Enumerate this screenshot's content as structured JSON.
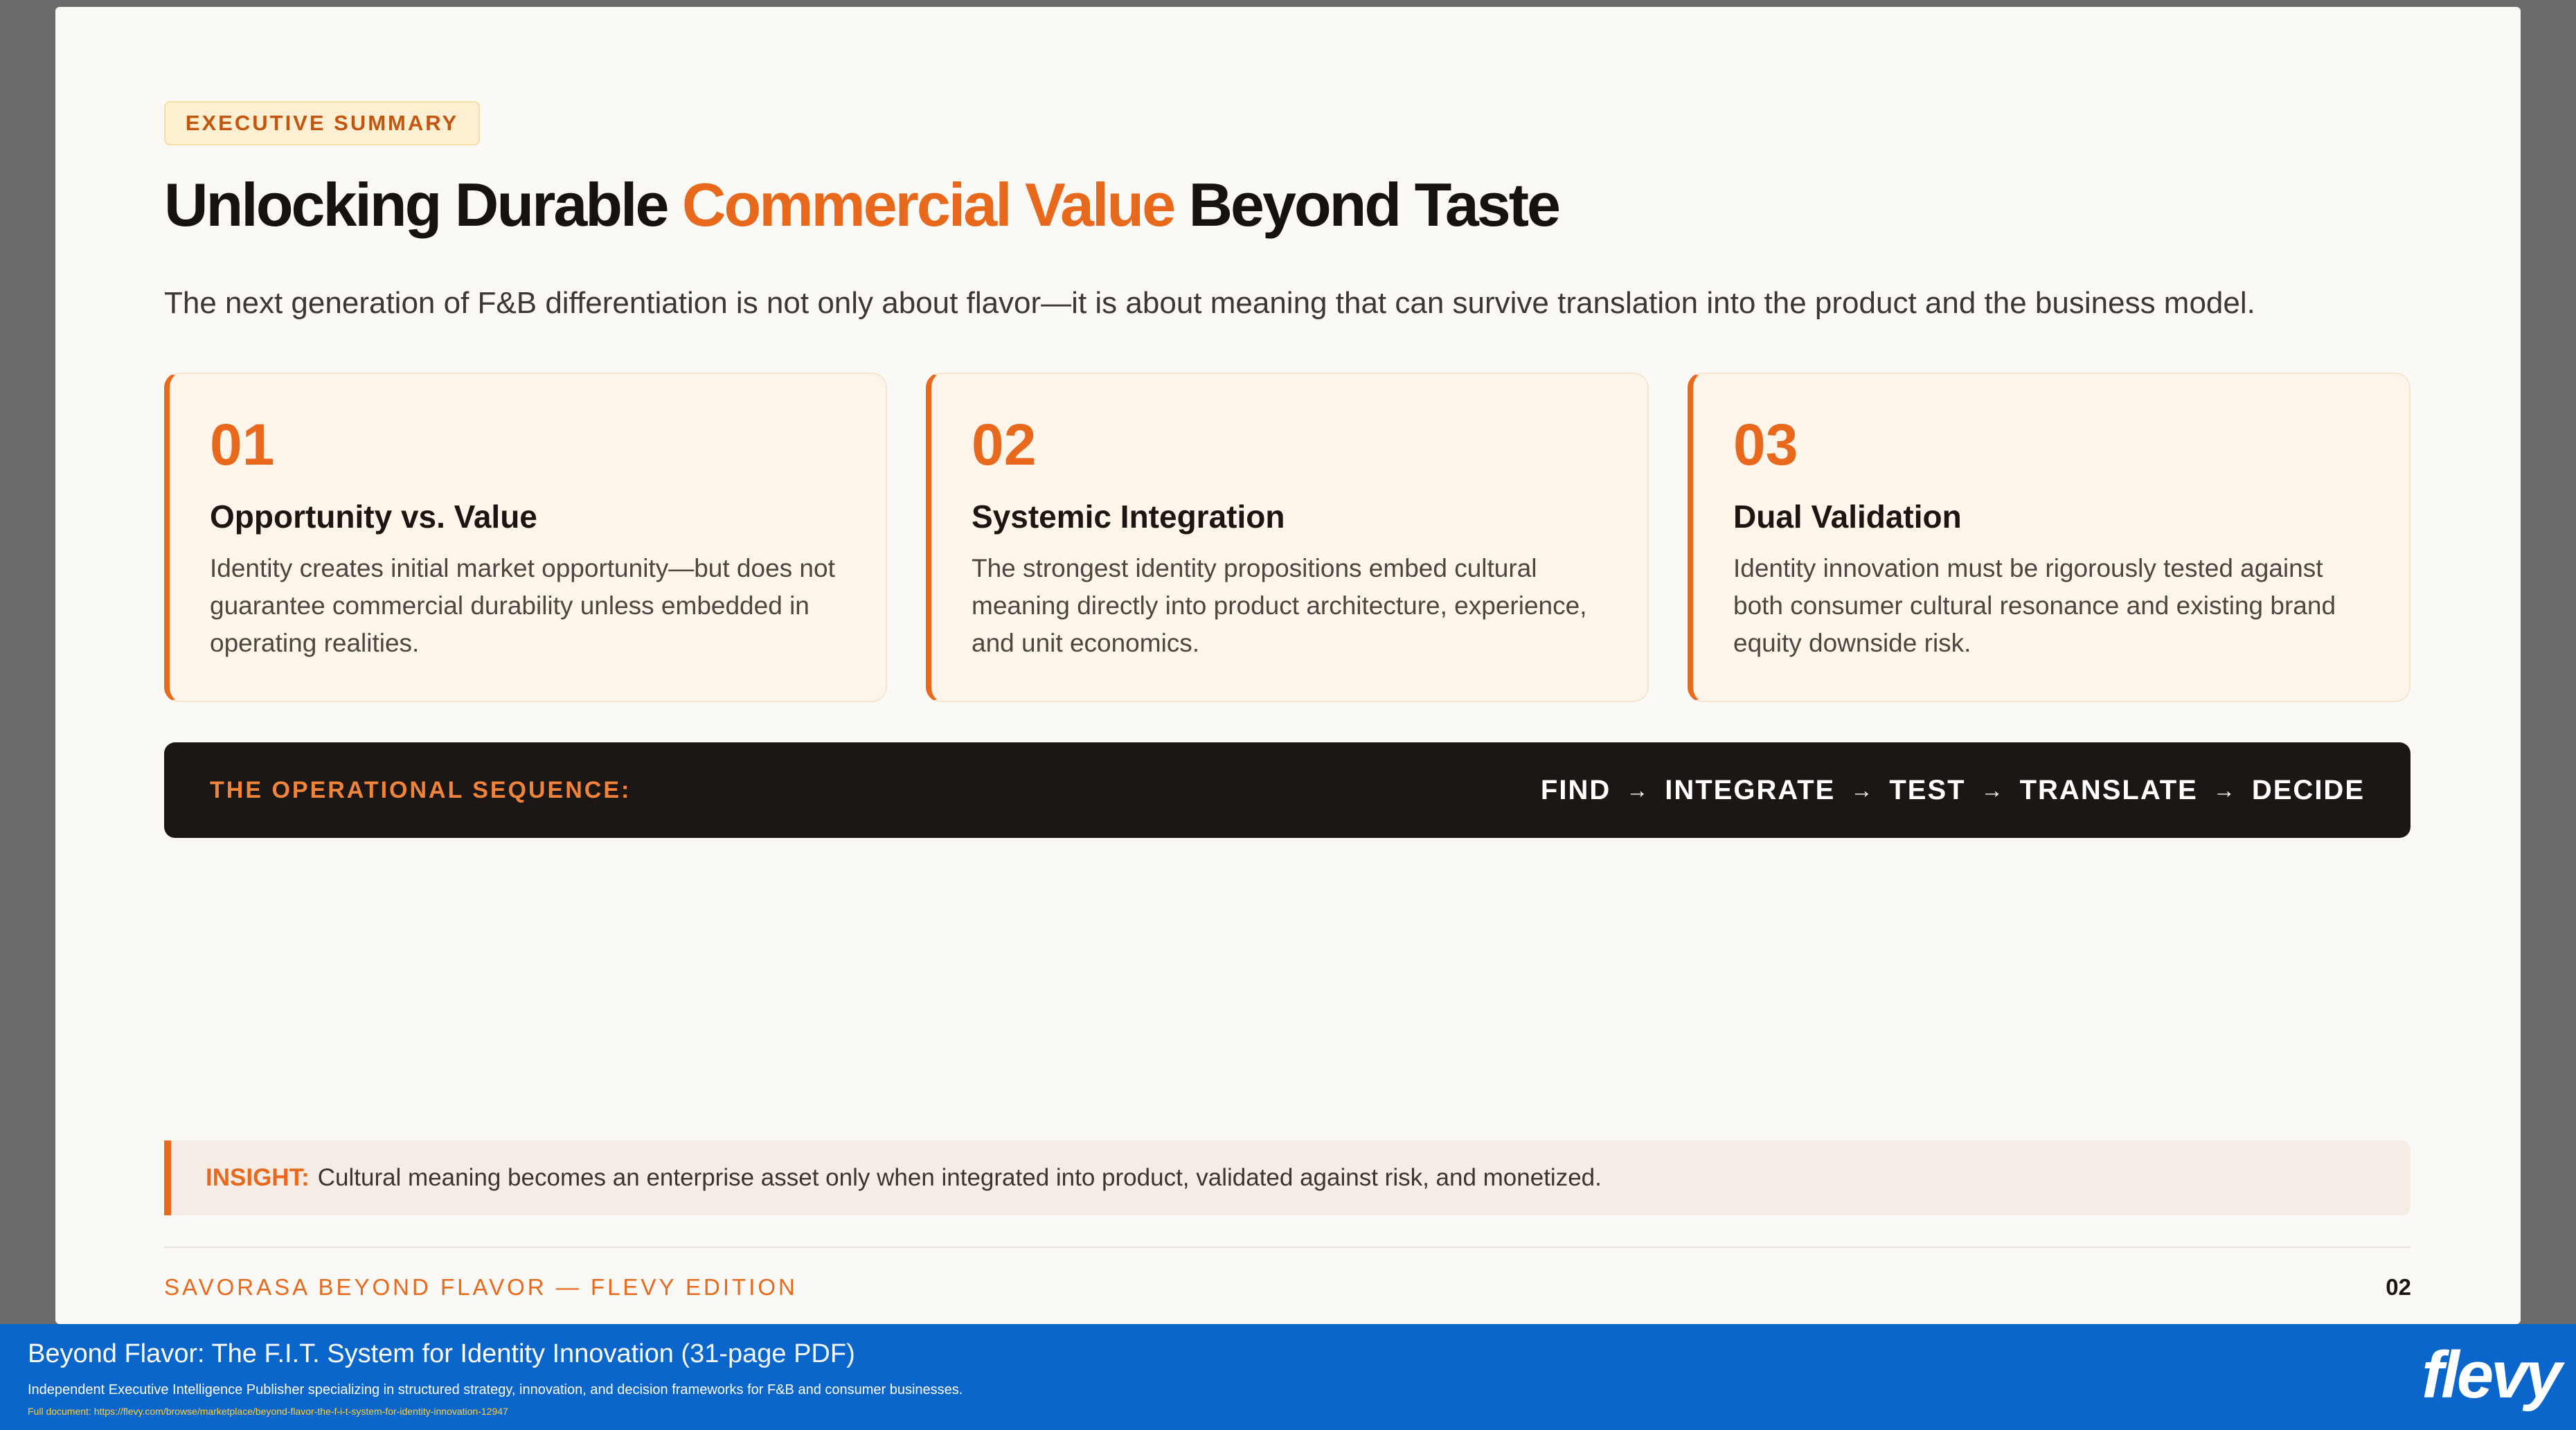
{
  "slide": {
    "badge": "EXECUTIVE SUMMARY",
    "title": {
      "part1": "Unlocking Durable ",
      "accent": "Commercial Value",
      "part2": " Beyond Taste"
    },
    "subtitle": "The next generation of F&B differentiation is not only about flavor—it is about meaning that can survive translation into the product and the business model.",
    "cards": [
      {
        "number": "01",
        "title": "Opportunity vs. Value",
        "body": "Identity creates initial market opportunity—but does not guarantee commercial durability unless embedded in operating realities."
      },
      {
        "number": "02",
        "title": "Systemic Integration",
        "body": "The strongest identity propositions embed cultural meaning directly into product architecture, experience, and unit economics."
      },
      {
        "number": "03",
        "title": "Dual Validation",
        "body": "Identity innovation must be rigorously tested against both consumer cultural resonance and existing brand equity downside risk."
      }
    ],
    "sequence": {
      "label": "THE OPERATIONAL SEQUENCE:",
      "steps": [
        "FIND",
        "INTEGRATE",
        "TEST",
        "TRANSLATE",
        "DECIDE"
      ],
      "arrow": "→"
    },
    "insight": {
      "label": "INSIGHT:",
      "text": "Cultural meaning becomes an enterprise asset only when integrated into product, validated against risk, and monetized."
    },
    "footer": {
      "brand": "SAVORASA BEYOND FLAVOR — FLEVY EDITION",
      "page": "02"
    }
  },
  "banner": {
    "title": "Beyond Flavor: The F.I.T. System for Identity Innovation",
    "pages": "(31-page PDF)",
    "description": "Independent Executive Intelligence Publisher specializing in structured strategy, innovation, and decision frameworks for F&B and consumer businesses.",
    "link": "Full document: https://flevy.com/browse/marketplace/beyond-flavor-the-f-i-t-system-for-identity-innovation-12947",
    "logo": "flevy"
  },
  "colors": {
    "accent": "#e8681c",
    "dark_bar": "#1c1714",
    "banner_blue": "#0b66cc",
    "slide_bg": "#fbf9f6"
  }
}
